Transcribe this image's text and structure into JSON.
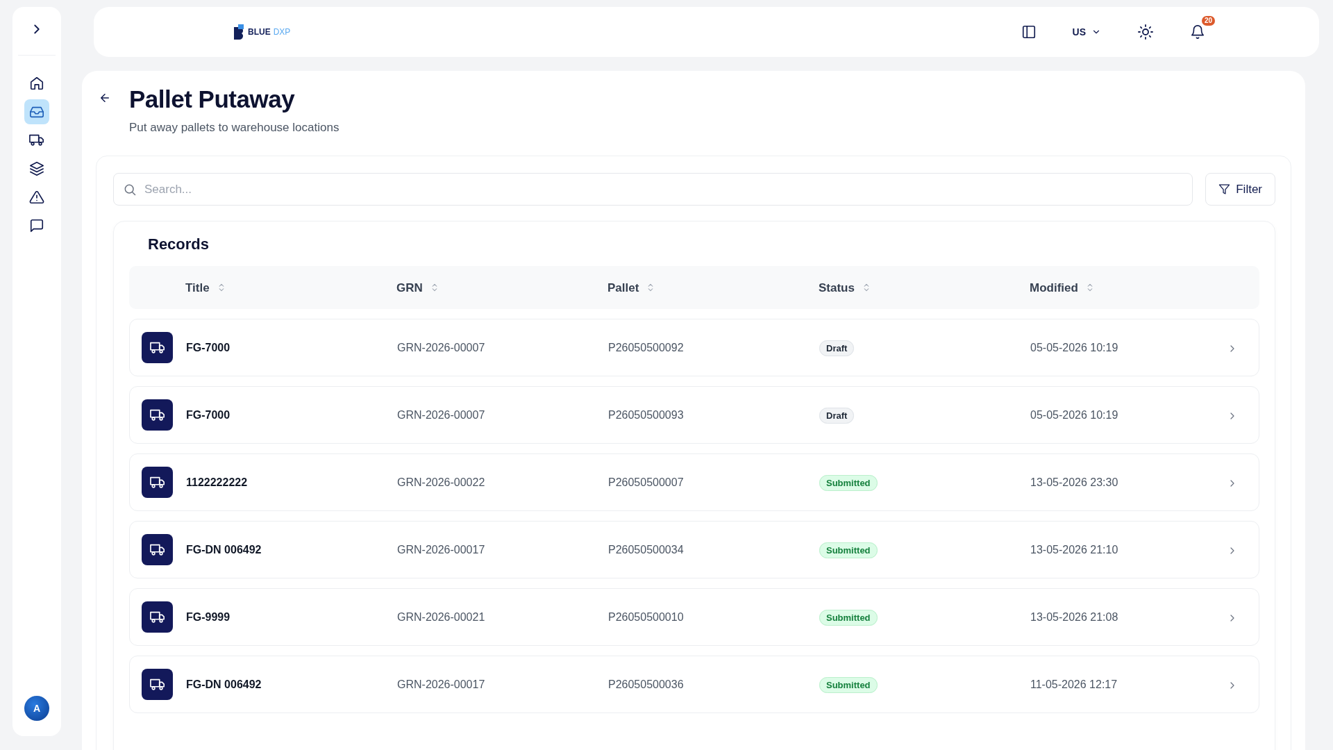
{
  "sidebar": {
    "items": [
      {
        "selected": false
      },
      {
        "selected": true
      },
      {
        "selected": false
      },
      {
        "selected": false
      },
      {
        "selected": false
      },
      {
        "selected": false
      }
    ],
    "avatar": "A"
  },
  "header": {
    "logo": {
      "part_1": "BLUE",
      "part_2": "DXP"
    },
    "region": "US",
    "notification_count": "20"
  },
  "page": {
    "title": "Pallet Putaway",
    "subtitle": "Put away pallets to warehouse locations"
  },
  "search": {
    "placeholder": "Search..."
  },
  "filter_button": "Filter",
  "records": {
    "title": "Records",
    "columns": [
      "Title",
      "GRN",
      "Pallet",
      "Status",
      "Modified"
    ],
    "rows": [
      {
        "title": "FG-7000",
        "grn": "GRN-2026-00007",
        "pallet": "P26050500092",
        "status": "Draft",
        "kind": "draft",
        "modified": "05-05-2026 10:19"
      },
      {
        "title": "FG-7000",
        "grn": "GRN-2026-00007",
        "pallet": "P26050500093",
        "status": "Draft",
        "kind": "draft",
        "modified": "05-05-2026 10:19"
      },
      {
        "title": "1122222222",
        "grn": "GRN-2026-00022",
        "pallet": "P26050500007",
        "status": "Submitted",
        "kind": "submitted",
        "modified": "13-05-2026 23:30"
      },
      {
        "title": "FG-DN 006492",
        "grn": "GRN-2026-00017",
        "pallet": "P26050500034",
        "status": "Submitted",
        "kind": "submitted",
        "modified": "13-05-2026 21:10"
      },
      {
        "title": "FG-9999",
        "grn": "GRN-2026-00021",
        "pallet": "P26050500010",
        "status": "Submitted",
        "kind": "submitted",
        "modified": "13-05-2026 21:08"
      },
      {
        "title": "FG-DN 006492",
        "grn": "GRN-2026-00017",
        "pallet": "P26050500036",
        "status": "Submitted",
        "kind": "submitted",
        "modified": "11-05-2026 12:17"
      }
    ]
  }
}
